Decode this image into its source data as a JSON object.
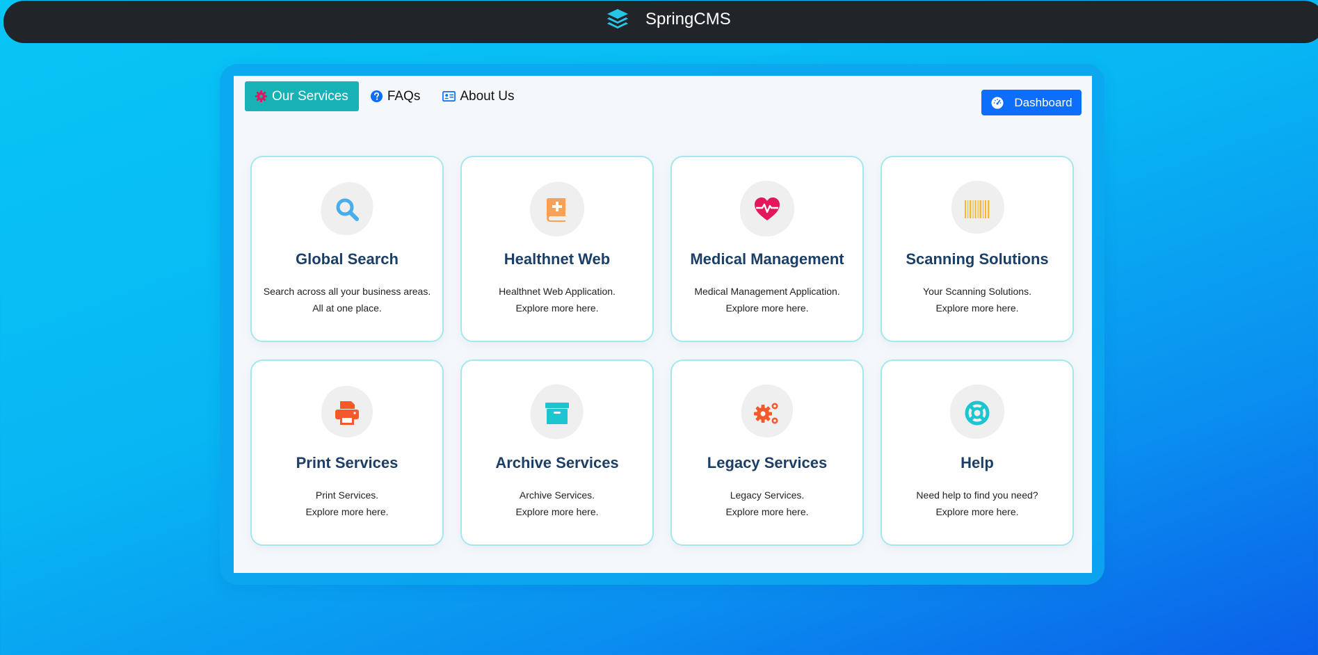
{
  "header": {
    "app_name": "SpringCMS",
    "logo_icon": "layers-icon"
  },
  "nav": {
    "tabs": [
      {
        "label": "Our Services",
        "icon": "gear-icon",
        "active": true
      },
      {
        "label": "FAQs",
        "icon": "question-circle-icon",
        "active": false
      },
      {
        "label": "About Us",
        "icon": "person-card-icon",
        "active": false
      }
    ],
    "dashboard_label": "Dashboard",
    "dashboard_icon": "speedometer-icon"
  },
  "colors": {
    "topbar": "#212529",
    "active_tab": "#17b1b6",
    "dashboard_button": "#0d6efd",
    "card_title": "#1b3f66",
    "card_border": "#a4e7ec"
  },
  "services": [
    {
      "title": "Global Search",
      "line1": "Search across all your business areas.",
      "line2": "All at one place.",
      "icon": "search-icon",
      "icon_color": "#47aeea"
    },
    {
      "title": "Healthnet Web",
      "line1": "Healthnet Web Application.",
      "line2": "Explore more here.",
      "icon": "medical-book-icon",
      "icon_color": "#f6a05a"
    },
    {
      "title": "Medical Management",
      "line1": "Medical Management Application.",
      "line2": "Explore more here.",
      "icon": "heart-pulse-icon",
      "icon_color": "#e3175c"
    },
    {
      "title": "Scanning Solutions",
      "line1": "Your Scanning Solutions.",
      "line2": "Explore more here.",
      "icon": "barcode-icon",
      "icon_color": "#f2b733"
    },
    {
      "title": "Print Services",
      "line1": "Print Services.",
      "line2": "Explore more here.",
      "icon": "printer-icon",
      "icon_color": "#f25a2c"
    },
    {
      "title": "Archive Services",
      "line1": "Archive Services.",
      "line2": "Explore more here.",
      "icon": "archive-box-icon",
      "icon_color": "#1cc5cf"
    },
    {
      "title": "Legacy Services",
      "line1": "Legacy Services.",
      "line2": "Explore more here.",
      "icon": "gears-icon",
      "icon_color": "#f25a2c"
    },
    {
      "title": "Help",
      "line1": "Need help to find you need?",
      "line2": "Explore more here.",
      "icon": "lifebuoy-icon",
      "icon_color": "#1cc5cf"
    }
  ]
}
